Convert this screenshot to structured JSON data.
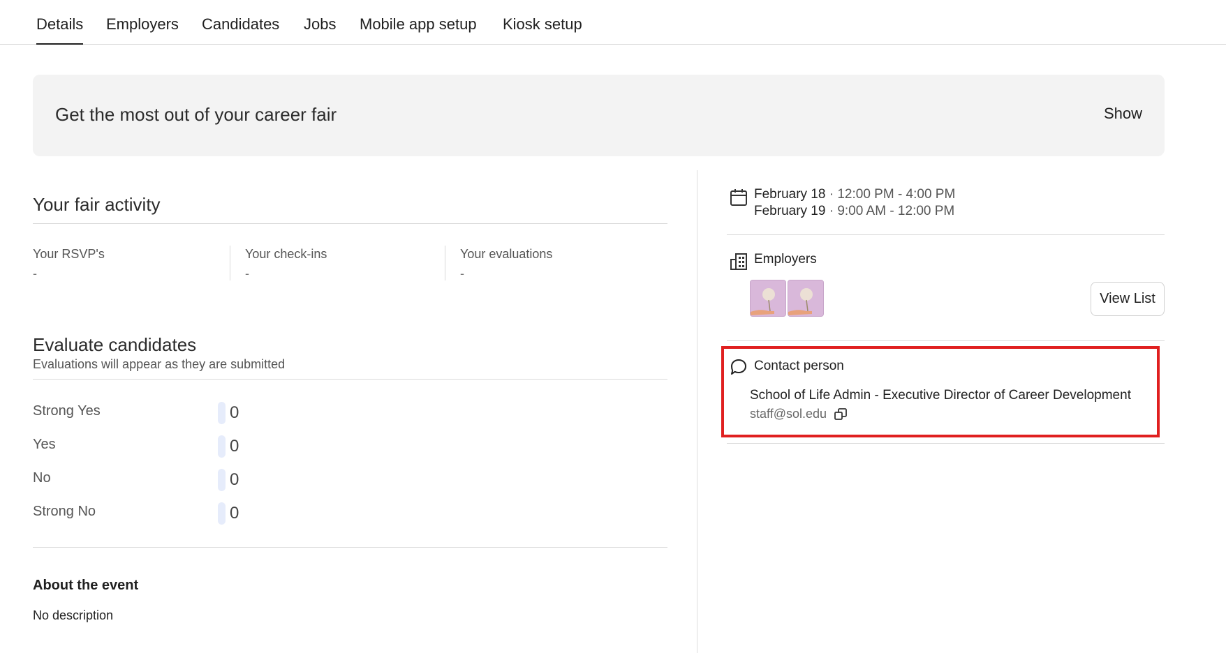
{
  "tabs": [
    {
      "label": "Details",
      "active": true
    },
    {
      "label": "Employers",
      "active": false
    },
    {
      "label": "Candidates",
      "active": false
    },
    {
      "label": "Jobs",
      "active": false
    },
    {
      "label": "Mobile app setup",
      "active": false
    },
    {
      "label": "Kiosk setup",
      "active": false
    }
  ],
  "banner": {
    "title": "Get the most out of your career fair",
    "action": "Show"
  },
  "activity": {
    "title": "Your fair activity",
    "stats": [
      {
        "label": "Your RSVP's",
        "value": "-"
      },
      {
        "label": "Your check-ins",
        "value": "-"
      },
      {
        "label": "Your evaluations",
        "value": "-"
      }
    ]
  },
  "evaluate": {
    "title": "Evaluate candidates",
    "subtitle": "Evaluations will appear as they are submitted",
    "rows": [
      {
        "label": "Strong Yes",
        "count": "0"
      },
      {
        "label": "Yes",
        "count": "0"
      },
      {
        "label": "No",
        "count": "0"
      },
      {
        "label": "Strong No",
        "count": "0"
      }
    ]
  },
  "about": {
    "title": "About the event",
    "text": "No description"
  },
  "sidebar": {
    "dates": [
      {
        "day": "February 18",
        "time": " · 12:00 PM - 4:00 PM"
      },
      {
        "day": "February 19",
        "time": " · 9:00 AM - 12:00 PM"
      }
    ],
    "employers_label": "Employers",
    "view_list": "View List",
    "contact": {
      "label": "Contact person",
      "name": "School of Life Admin - Executive Director of Career Development",
      "email": "staff@sol.edu"
    }
  },
  "colors": {
    "highlight": "#e02020",
    "eval_bar": "#e6ecfb",
    "banner_bg": "#f3f3f3"
  }
}
